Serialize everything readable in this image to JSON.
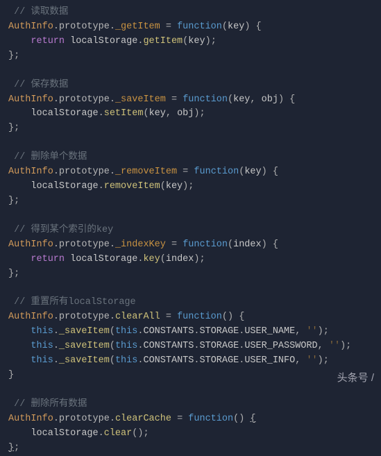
{
  "c1": "// 读取数据",
  "c2": "// 保存数据",
  "c3": "// 删除单个数据",
  "c4": "// 得到某个索引的key",
  "c5": "// 重置所有localStorage",
  "c6": "// 删除所有数据",
  "cls": "AuthInfo",
  "proto": "prototype",
  "m1": "_getItem",
  "m2": "_saveItem",
  "m3": "_removeItem",
  "m4": "_indexKey",
  "m5": "clearAll",
  "m6": "clearCache",
  "fn": "function",
  "ret": "return",
  "ls": "localStorage",
  "get": "getItem",
  "set": "setItem",
  "rem": "removeItem",
  "keyfn": "key",
  "clear": "clear",
  "this": "this",
  "save": "_saveItem",
  "const": "CONSTANTS",
  "store": "STORAGE",
  "un": "USER_NAME",
  "up": "USER_PASSWORD",
  "ui": "USER_INFO",
  "key": "key",
  "obj": "obj",
  "index": "index",
  "empty": "''",
  "watermark": "头条号 /"
}
